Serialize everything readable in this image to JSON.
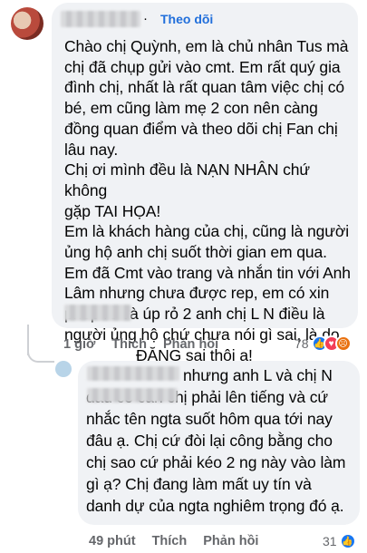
{
  "comment1": {
    "follow_label": "Theo dõi",
    "dot": "·",
    "paragraphs": [
      "Chào chị Quỳnh, em là chủ nhân Tus mà\nchị đã chụp gửi vào cmt. Em rất quý gia\nđình chị, nhất là rất quan tâm việc chị có\nbé, em cũng làm mẹ 2 con nên càng\nđồng quan điểm và theo dõi chị Fan chị\nlâu nay.",
      "Chị ơi mình đều là NẠN NHÂN chứ không\ngặp TAI HỌA!",
      "Em là khách hàng của chị, cũng là người\nủng hộ anh chị suốt thời gian em qua.",
      "Em đã Cmt vào trang và nhắn tin với Anh\nLâm nhưng chưa được rep, em có xin\nphép rỏ và úp rỏ 2 anh chị L N điều là\nngười ủng hộ chứ chưa nói gì sai, là do"
    ],
    "last_line_tail": "ĐĂNG sai thôi ạ!",
    "time": "1 giờ",
    "like_label": "Thích",
    "reply_label": "Phản hồi",
    "reaction_count": "78"
  },
  "comment2": {
    "first_line_tail": "nhưng anh L và chị N",
    "text": "đâu có cần chị phải lên tiếng và cứ\nnhắc tên ngta suốt hôm qua tới nay\nđâu ạ. Chị cứ đòi lại công bằng cho\nchị sao cứ phải kéo 2 ng này vào làm\ngì ạ? Chị đang làm mất uy tín và\ndanh dự của ngta nghiêm trọng đó ạ.",
    "time": "49 phút",
    "like_label": "Thích",
    "reply_label": "Phản hồi",
    "reaction_count": "31"
  },
  "colors": {
    "accent": "#216fdb",
    "bubble": "#f0f2f5",
    "meta": "#65676b"
  },
  "icons": [
    "like-icon",
    "love-icon",
    "angry-icon"
  ]
}
